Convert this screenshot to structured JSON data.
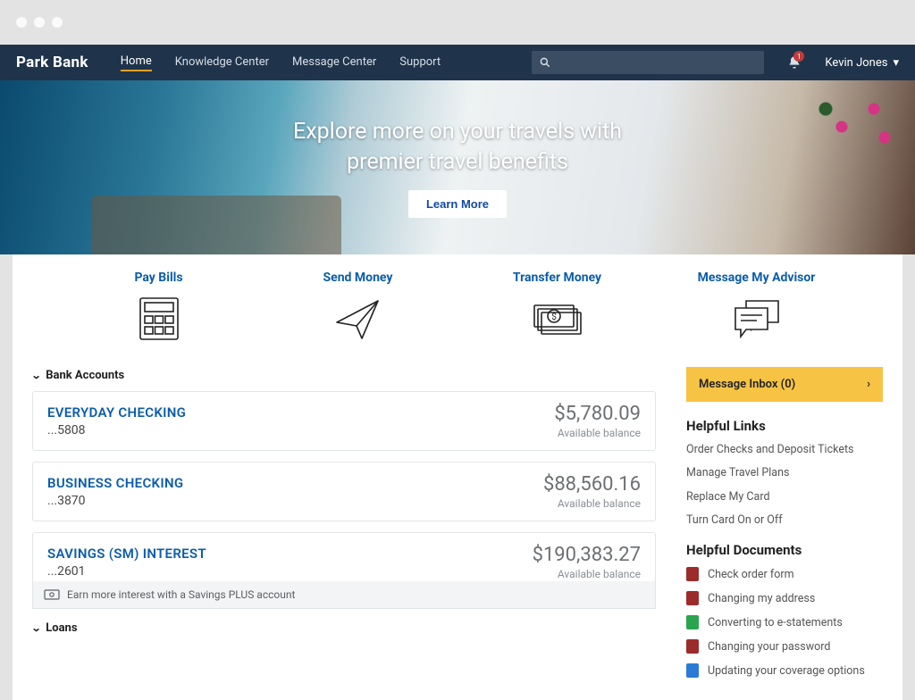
{
  "brand": "Park Bank",
  "nav": {
    "items": [
      "Home",
      "Knowledge Center",
      "Message Center",
      "Support"
    ],
    "active_index": 0
  },
  "search": {
    "placeholder": ""
  },
  "user": {
    "name": "Kevin Jones",
    "notification_count": "1"
  },
  "hero": {
    "line1": "Explore more on your travels with",
    "line2": "premier travel benefits",
    "cta": "Learn More"
  },
  "quick_actions": [
    {
      "label": "Pay Bills",
      "icon": "calculator-icon"
    },
    {
      "label": "Send Money",
      "icon": "paper-plane-icon"
    },
    {
      "label": "Transfer Money",
      "icon": "cash-transfer-icon"
    },
    {
      "label": "Message My Advisor",
      "icon": "chat-bubbles-icon"
    }
  ],
  "sections": {
    "bank_accounts_title": "Bank Accounts",
    "loans_title": "Loans"
  },
  "accounts": [
    {
      "name": "EVERYDAY CHECKING",
      "mask": "...5808",
      "balance": "$5,780.09",
      "balance_label": "Available balance"
    },
    {
      "name": "BUSINESS CHECKING",
      "mask": "...3870",
      "balance": "$88,560.16",
      "balance_label": "Available balance"
    },
    {
      "name": "SAVINGS (SM) INTEREST",
      "mask": "...2601",
      "balance": "$190,383.27",
      "balance_label": "Available balance"
    }
  ],
  "savings_promo": "Earn more interest with a Savings PLUS account",
  "inbox": {
    "label": "Message Inbox (0)"
  },
  "helpful_links": {
    "title": "Helpful Links",
    "items": [
      "Order Checks and Deposit Tickets",
      "Manage Travel Plans",
      "Replace My Card",
      "Turn Card On or Off"
    ]
  },
  "helpful_documents": {
    "title": "Helpful Documents",
    "items": [
      {
        "label": "Check order form",
        "color": "pdf-red"
      },
      {
        "label": "Changing my address",
        "color": "pdf-red"
      },
      {
        "label": "Converting to e-statements",
        "color": "doc-green"
      },
      {
        "label": "Changing your password",
        "color": "pdf-red"
      },
      {
        "label": "Updating your coverage options",
        "color": "doc-blue"
      }
    ]
  }
}
